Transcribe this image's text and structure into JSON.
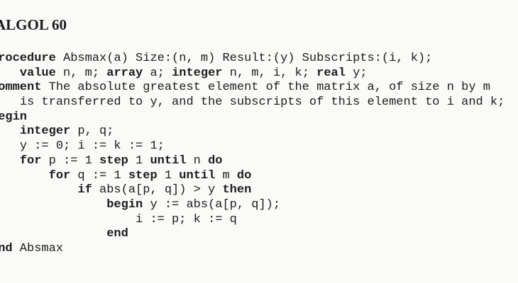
{
  "heading": "ALGOL 60",
  "code_lines": [
    {
      "indent": 0,
      "segments": [
        {
          "text": "procedure",
          "kw": true
        },
        {
          "text": " Absmax(a) Size:(n, m) Result:(y) Subscripts:(i, k);",
          "kw": false
        }
      ]
    },
    {
      "indent": 4,
      "segments": [
        {
          "text": "value",
          "kw": true
        },
        {
          "text": " n, m; ",
          "kw": false
        },
        {
          "text": "array",
          "kw": true
        },
        {
          "text": " a; ",
          "kw": false
        },
        {
          "text": "integer",
          "kw": true
        },
        {
          "text": " n, m, i, k; ",
          "kw": false
        },
        {
          "text": "real",
          "kw": true
        },
        {
          "text": " y;",
          "kw": false
        }
      ]
    },
    {
      "indent": 0,
      "segments": [
        {
          "text": "comment",
          "kw": true
        },
        {
          "text": " The absolute greatest element of the matrix a, of size n by m",
          "kw": false
        }
      ]
    },
    {
      "indent": 4,
      "segments": [
        {
          "text": "is transferred to y, and the subscripts of this element to i and k;",
          "kw": false
        }
      ]
    },
    {
      "indent": 0,
      "segments": [
        {
          "text": "begin",
          "kw": true
        }
      ]
    },
    {
      "indent": 4,
      "segments": [
        {
          "text": "integer",
          "kw": true
        },
        {
          "text": " p, q;",
          "kw": false
        }
      ]
    },
    {
      "indent": 4,
      "segments": [
        {
          "text": "y := 0; i := k := 1;",
          "kw": false
        }
      ]
    },
    {
      "indent": 4,
      "segments": [
        {
          "text": "for",
          "kw": true
        },
        {
          "text": " p := 1 ",
          "kw": false
        },
        {
          "text": "step",
          "kw": true
        },
        {
          "text": " 1 ",
          "kw": false
        },
        {
          "text": "until",
          "kw": true
        },
        {
          "text": " n ",
          "kw": false
        },
        {
          "text": "do",
          "kw": true
        }
      ]
    },
    {
      "indent": 8,
      "segments": [
        {
          "text": "for",
          "kw": true
        },
        {
          "text": " q := 1 ",
          "kw": false
        },
        {
          "text": "step",
          "kw": true
        },
        {
          "text": " 1 ",
          "kw": false
        },
        {
          "text": "until",
          "kw": true
        },
        {
          "text": " m ",
          "kw": false
        },
        {
          "text": "do",
          "kw": true
        }
      ]
    },
    {
      "indent": 12,
      "segments": [
        {
          "text": "if",
          "kw": true
        },
        {
          "text": " abs(a[p, q]) > y ",
          "kw": false
        },
        {
          "text": "then",
          "kw": true
        }
      ]
    },
    {
      "indent": 16,
      "segments": [
        {
          "text": "begin",
          "kw": true
        },
        {
          "text": " y := abs(a[p, q]);",
          "kw": false
        }
      ]
    },
    {
      "indent": 20,
      "segments": [
        {
          "text": "i := p; k := q",
          "kw": false
        }
      ]
    },
    {
      "indent": 16,
      "segments": [
        {
          "text": "end",
          "kw": true
        }
      ]
    },
    {
      "indent": 0,
      "segments": [
        {
          "text": "end",
          "kw": true
        },
        {
          "text": " Absmax",
          "kw": false
        }
      ]
    }
  ]
}
